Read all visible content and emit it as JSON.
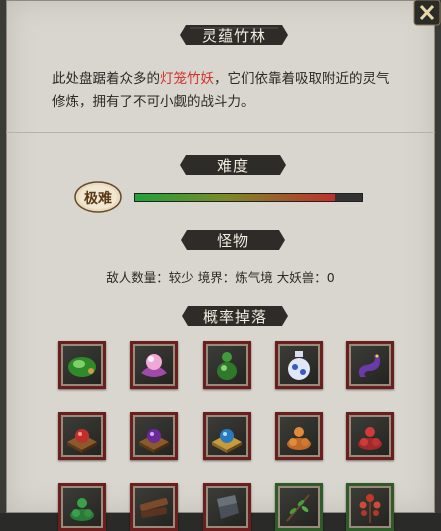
{
  "title": "灵蕴竹林",
  "description": {
    "before": "此处盘踞着众多的",
    "highlight": "灯笼竹妖",
    "after": "，它们依靠着吸取附近的灵气修炼，拥有了不可小觑的战斗力。"
  },
  "difficulty": {
    "heading": "难度",
    "level_label": "极难",
    "level_fraction": 0.88
  },
  "monsters": {
    "heading": "怪物",
    "stats_text": "敌人数量：较少 境界：炼气境 大妖兽：0"
  },
  "drops": {
    "heading": "概率掉落",
    "items": [
      {
        "icon": "green-jade-orb-icon",
        "frame": "red"
      },
      {
        "icon": "pink-pearl-lotus-icon",
        "frame": "red"
      },
      {
        "icon": "green-gourd-icon",
        "frame": "red"
      },
      {
        "icon": "blue-porcelain-vase-icon",
        "frame": "red"
      },
      {
        "icon": "purple-serpent-icon",
        "frame": "red"
      },
      {
        "icon": "red-gem-on-pedestal-icon",
        "frame": "red"
      },
      {
        "icon": "purple-gem-on-pedestal-icon",
        "frame": "red"
      },
      {
        "icon": "blue-gem-on-pedestal-icon",
        "frame": "red"
      },
      {
        "icon": "orange-ore-pile-icon",
        "frame": "red"
      },
      {
        "icon": "red-ore-pile-icon",
        "frame": "red"
      },
      {
        "icon": "green-ore-pile-icon",
        "frame": "red"
      },
      {
        "icon": "wooden-planks-icon",
        "frame": "red"
      },
      {
        "icon": "dark-stone-block-icon",
        "frame": "red"
      },
      {
        "icon": "herb-branch-icon",
        "frame": "green"
      },
      {
        "icon": "red-herb-icon",
        "frame": "green"
      }
    ]
  },
  "colors": {
    "highlight_red": "#d2302b",
    "banner_bg": "#2e2c29",
    "slot_frame_red": "#6a1f1e",
    "slot_frame_green": "#2f5a2a"
  }
}
